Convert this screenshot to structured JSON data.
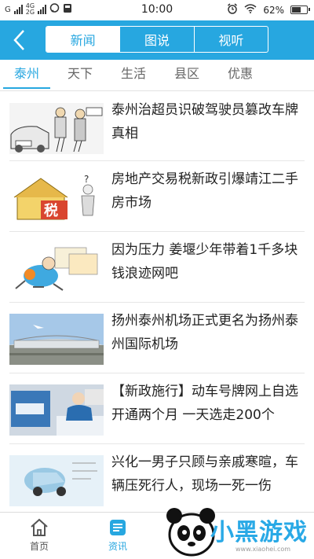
{
  "status_bar": {
    "carrier_left": "G",
    "net_top": "4G",
    "net_bottom": "2G",
    "time": "10:00",
    "battery": "62%",
    "battery_level": 0.62
  },
  "header": {
    "tabs": [
      {
        "label": "新闻",
        "active": true
      },
      {
        "label": "图说",
        "active": false
      },
      {
        "label": "视听",
        "active": false
      }
    ]
  },
  "categories": [
    {
      "label": "泰州",
      "active": true
    },
    {
      "label": "天下",
      "active": false
    },
    {
      "label": "生活",
      "active": false
    },
    {
      "label": "县区",
      "active": false
    },
    {
      "label": "优惠",
      "active": false
    }
  ],
  "news": [
    {
      "title": "泰州治超员识破驾驶员篡改车牌真相"
    },
    {
      "title": "房地产交易税新政引爆靖江二手房市场"
    },
    {
      "title": "因为压力 姜堰少年带着1千多块钱浪迹网吧"
    },
    {
      "title": "扬州泰州机场正式更名为扬州泰州国际机场"
    },
    {
      "title": "【新政施行】动车号牌网上自选开通两个月 一天选走200个"
    },
    {
      "title": "兴化一男子只顾与亲戚寒暄，车辆压死行人，现场一死一伤"
    }
  ],
  "bottom_nav": [
    {
      "label": "首页",
      "active": false,
      "icon": "home-icon"
    },
    {
      "label": "资讯",
      "active": true,
      "icon": "news-icon"
    }
  ],
  "watermark": {
    "brand": "小黑游戏",
    "url": "www.xiaohei.com"
  },
  "colors": {
    "accent": "#27a7e0",
    "text": "#222222",
    "muted": "#666666"
  }
}
